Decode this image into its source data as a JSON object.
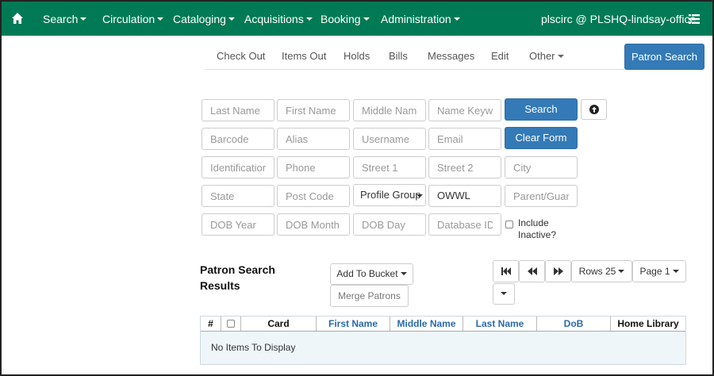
{
  "navbar": {
    "items": [
      {
        "label": "Search"
      },
      {
        "label": "Circulation"
      },
      {
        "label": "Cataloging"
      },
      {
        "label": "Acquisitions"
      },
      {
        "label": "Booking"
      },
      {
        "label": "Administration"
      }
    ],
    "user": "plscirc @ PLSHQ-lindsay-office",
    "icons": {
      "home": "home-icon",
      "menu": "list-menu-icon"
    }
  },
  "tabs": [
    {
      "label": "Check Out"
    },
    {
      "label": "Items Out"
    },
    {
      "label": "Holds"
    },
    {
      "label": "Bills"
    },
    {
      "label": "Messages"
    },
    {
      "label": "Edit"
    },
    {
      "label": "Other"
    }
  ],
  "patron_search_button": "Patron Search",
  "form": {
    "placeholders": {
      "last_name": "Last Name",
      "first_name": "First Name",
      "middle_name": "Middle Name",
      "name_keywords": "Name Keywo",
      "barcode": "Barcode",
      "alias": "Alias",
      "username": "Username",
      "email": "Email",
      "identification": "Identification",
      "phone": "Phone",
      "street1": "Street 1",
      "street2": "Street 2",
      "city": "City",
      "state": "State",
      "post_code": "Post Code",
      "parent_guardian": "Parent/Guard",
      "dob_year": "DOB Year",
      "dob_month": "DOB Month",
      "dob_day": "DOB Day",
      "database_id": "Database ID"
    },
    "profile_group": "Profile Group",
    "home_org": "OWWL",
    "search_button": "Search",
    "clear_button": "Clear Form",
    "include_inactive": "Include Inactive?",
    "include_inactive_checked": false
  },
  "results": {
    "title": "Patron Search Results",
    "add_to_bucket": "Add To Bucket",
    "merge_patrons": "Merge Patrons",
    "rows": "Rows 25",
    "page": "Page 1",
    "columns": [
      "#",
      "Card",
      "First Name",
      "Middle Name",
      "Last Name",
      "DoB",
      "Home Library"
    ],
    "empty_message": "No Items To Display"
  },
  "colors": {
    "navbar": "#007a54",
    "primary": "#337ab7",
    "header_link": "#2a6aa8",
    "grid_body": "#eef6fa"
  }
}
